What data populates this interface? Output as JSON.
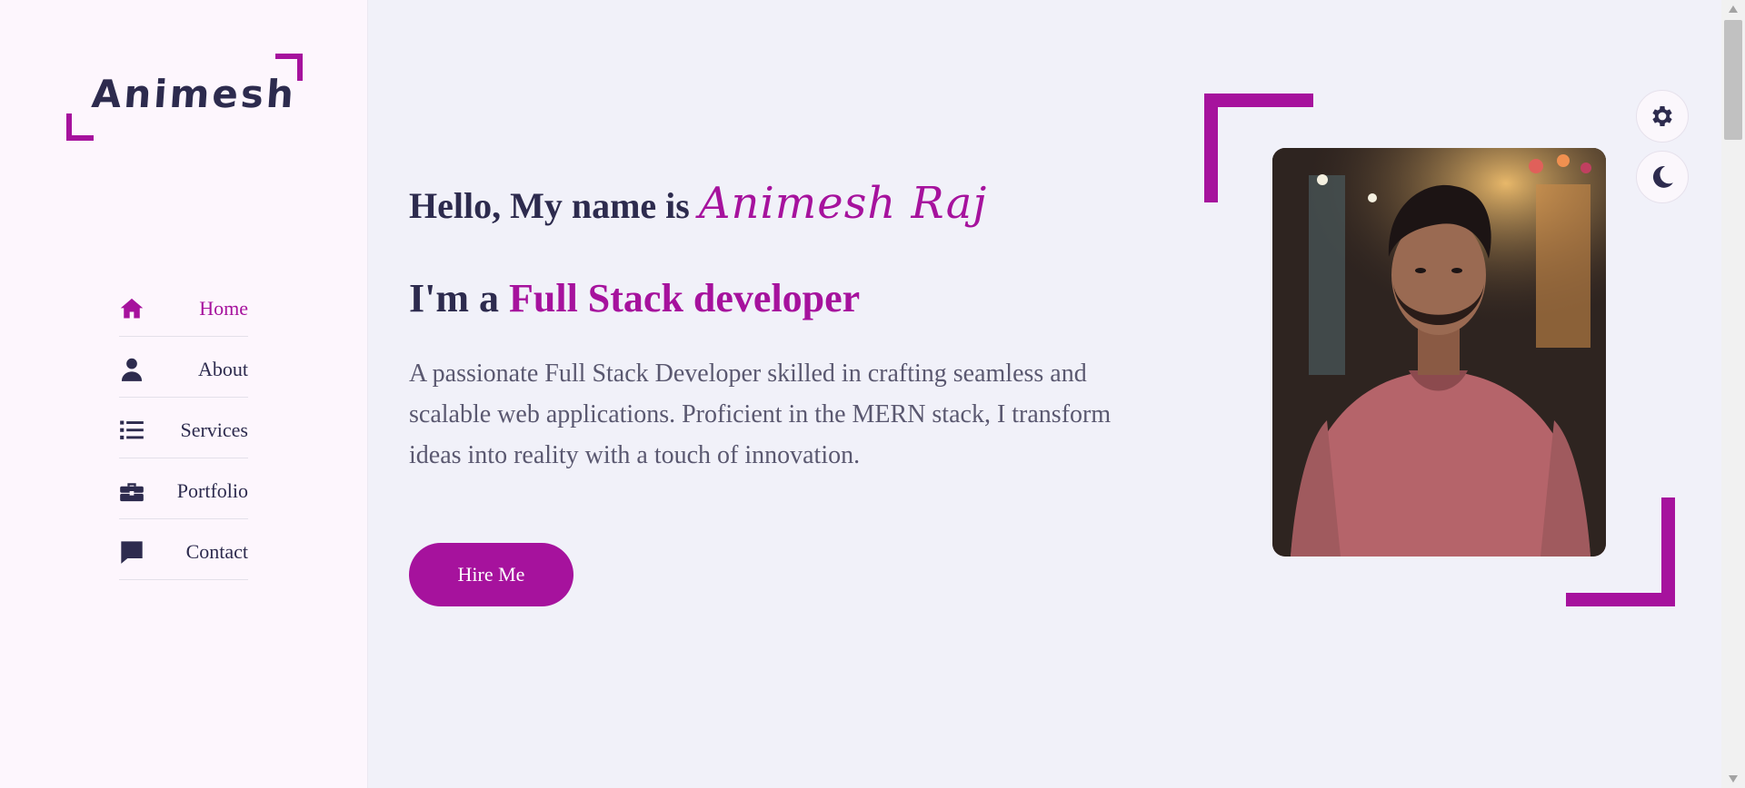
{
  "brand": {
    "logo_text": "Animesh",
    "accent_color": "#a6129d",
    "text_color": "#2d2b4e"
  },
  "nav": {
    "items": [
      {
        "label": "Home",
        "icon": "home-icon",
        "active": true
      },
      {
        "label": "About",
        "icon": "user-icon",
        "active": false
      },
      {
        "label": "Services",
        "icon": "list-icon",
        "active": false
      },
      {
        "label": "Portfolio",
        "icon": "briefcase-icon",
        "active": false
      },
      {
        "label": "Contact",
        "icon": "comment-icon",
        "active": false
      }
    ]
  },
  "hero": {
    "greeting": "Hello, My name is ",
    "name": "Animesh Raj",
    "role_prefix": "I'm a ",
    "role": "Full Stack developer",
    "description": "A passionate Full Stack Developer skilled in crafting seamless and scalable web applications. Proficient in the MERN stack, I transform ideas into reality with a touch of innovation.",
    "cta_label": "Hire Me",
    "photo": "profile-photo"
  },
  "controls": {
    "settings_icon": "gear-icon",
    "theme_icon": "moon-icon"
  }
}
